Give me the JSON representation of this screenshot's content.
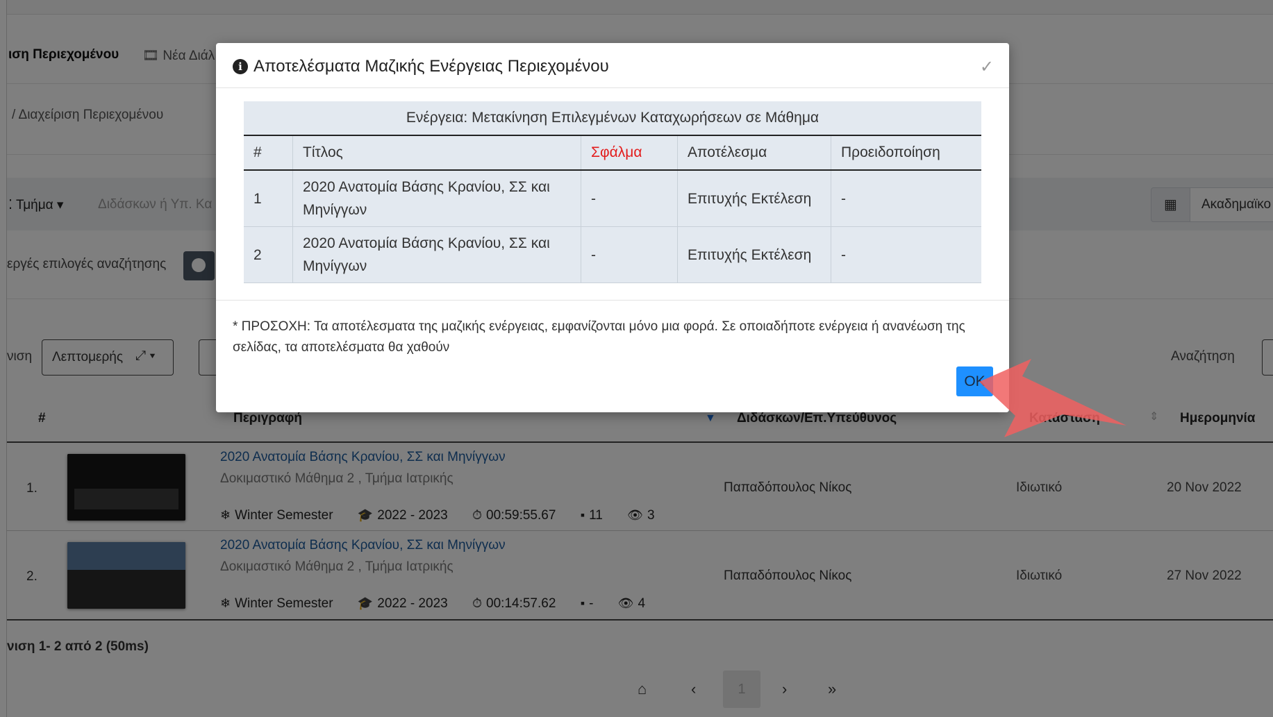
{
  "background": {
    "header": {
      "page_title_fragment": "ιση Περιεχομένου",
      "new_item_fragment": "Νέα Διάλ"
    },
    "breadcrumb": "/ Διαχείριση Περιεχομένου",
    "filters": {
      "department_label": "Τμήμα",
      "instructor_placeholder": "Διδάσκων ή Υπ. Κα",
      "academic_label": "Ακαδημαϊκο"
    },
    "active_filters_label": "εργές επιλογές αναζήτησης",
    "view": {
      "view_label_fragment": "νιση",
      "view_select": "Λεπτομερής",
      "search_label": "Αναζήτηση"
    },
    "table": {
      "columns": [
        "#",
        "Περιγραφή",
        "Διδάσκων/Επ.Υπεύθυνος",
        "Κατάσταση",
        "Ημερομηνία"
      ],
      "rows": [
        {
          "num": "1.",
          "title": "2020 Ανατομία Βάσης Κρανίου, ΣΣ και Μηνίγγων",
          "subtitle": "Δοκιμαστικό Μάθημα 2 , Τμήμα Ιατρικής",
          "semester": "Winter Semester",
          "year": "2022 - 2023",
          "duration": "00:59:55.67",
          "comments": "11",
          "views": "3",
          "instructor": "Παπαδόπουλος Νίκος",
          "status": "Ιδιωτικό",
          "date": "20 Nov 2022"
        },
        {
          "num": "2.",
          "title": "2020 Ανατομία Βάσης Κρανίου, ΣΣ και Μηνίγγων",
          "subtitle": "Δοκιμαστικό Μάθημα 2 , Τμήμα Ιατρικής",
          "semester": "Winter Semester",
          "year": "2022 - 2023",
          "duration": "00:14:57.62",
          "comments": "-",
          "views": "4",
          "instructor": "Παπαδόπουλος Νίκος",
          "status": "Ιδιωτικό",
          "date": "27 Nov 2022"
        }
      ]
    },
    "footer_count": "νιση 1- 2 από 2 (50ms)",
    "pagination": {
      "current_page": "1"
    }
  },
  "modal": {
    "title": "Αποτελέσματα Μαζικής Ενέργειας Περιεχομένου",
    "caption": "Ενέργεια: Μετακίνηση Επιλεγμένων Καταχωρήσεων σε Μάθημα",
    "columns": [
      "#",
      "Τίτλος",
      "Σφάλμα",
      "Αποτέλεσμα",
      "Προειδοποίηση"
    ],
    "rows": [
      {
        "num": "1",
        "title": "2020 Ανατομία Βάσης Κρανίου, ΣΣ και Μηνίγγων",
        "error": "-",
        "result": "Επιτυχής Εκτέλεση",
        "warning": "-"
      },
      {
        "num": "2",
        "title": "2020 Ανατομία Βάσης Κρανίου, ΣΣ και Μηνίγγων",
        "error": "-",
        "result": "Επιτυχής Εκτέλεση",
        "warning": "-"
      }
    ],
    "note": "* ΠΡΟΣΟΧΗ: Τα αποτέλεσματα της μαζικής ενέργειας, εμφανίζονται μόνο μια φορά. Σε οποιαδήποτε ενέργεια ή ανανέωση της σελίδας, τα αποτελέσματα θα χαθούν",
    "ok_label": "OK"
  },
  "colors": {
    "overlay": "#808080",
    "ok_button": "#1e90ff",
    "error_header": "#e31c1c",
    "annotation_arrow": "#f06060",
    "table_bg": "#e3e9f0"
  }
}
